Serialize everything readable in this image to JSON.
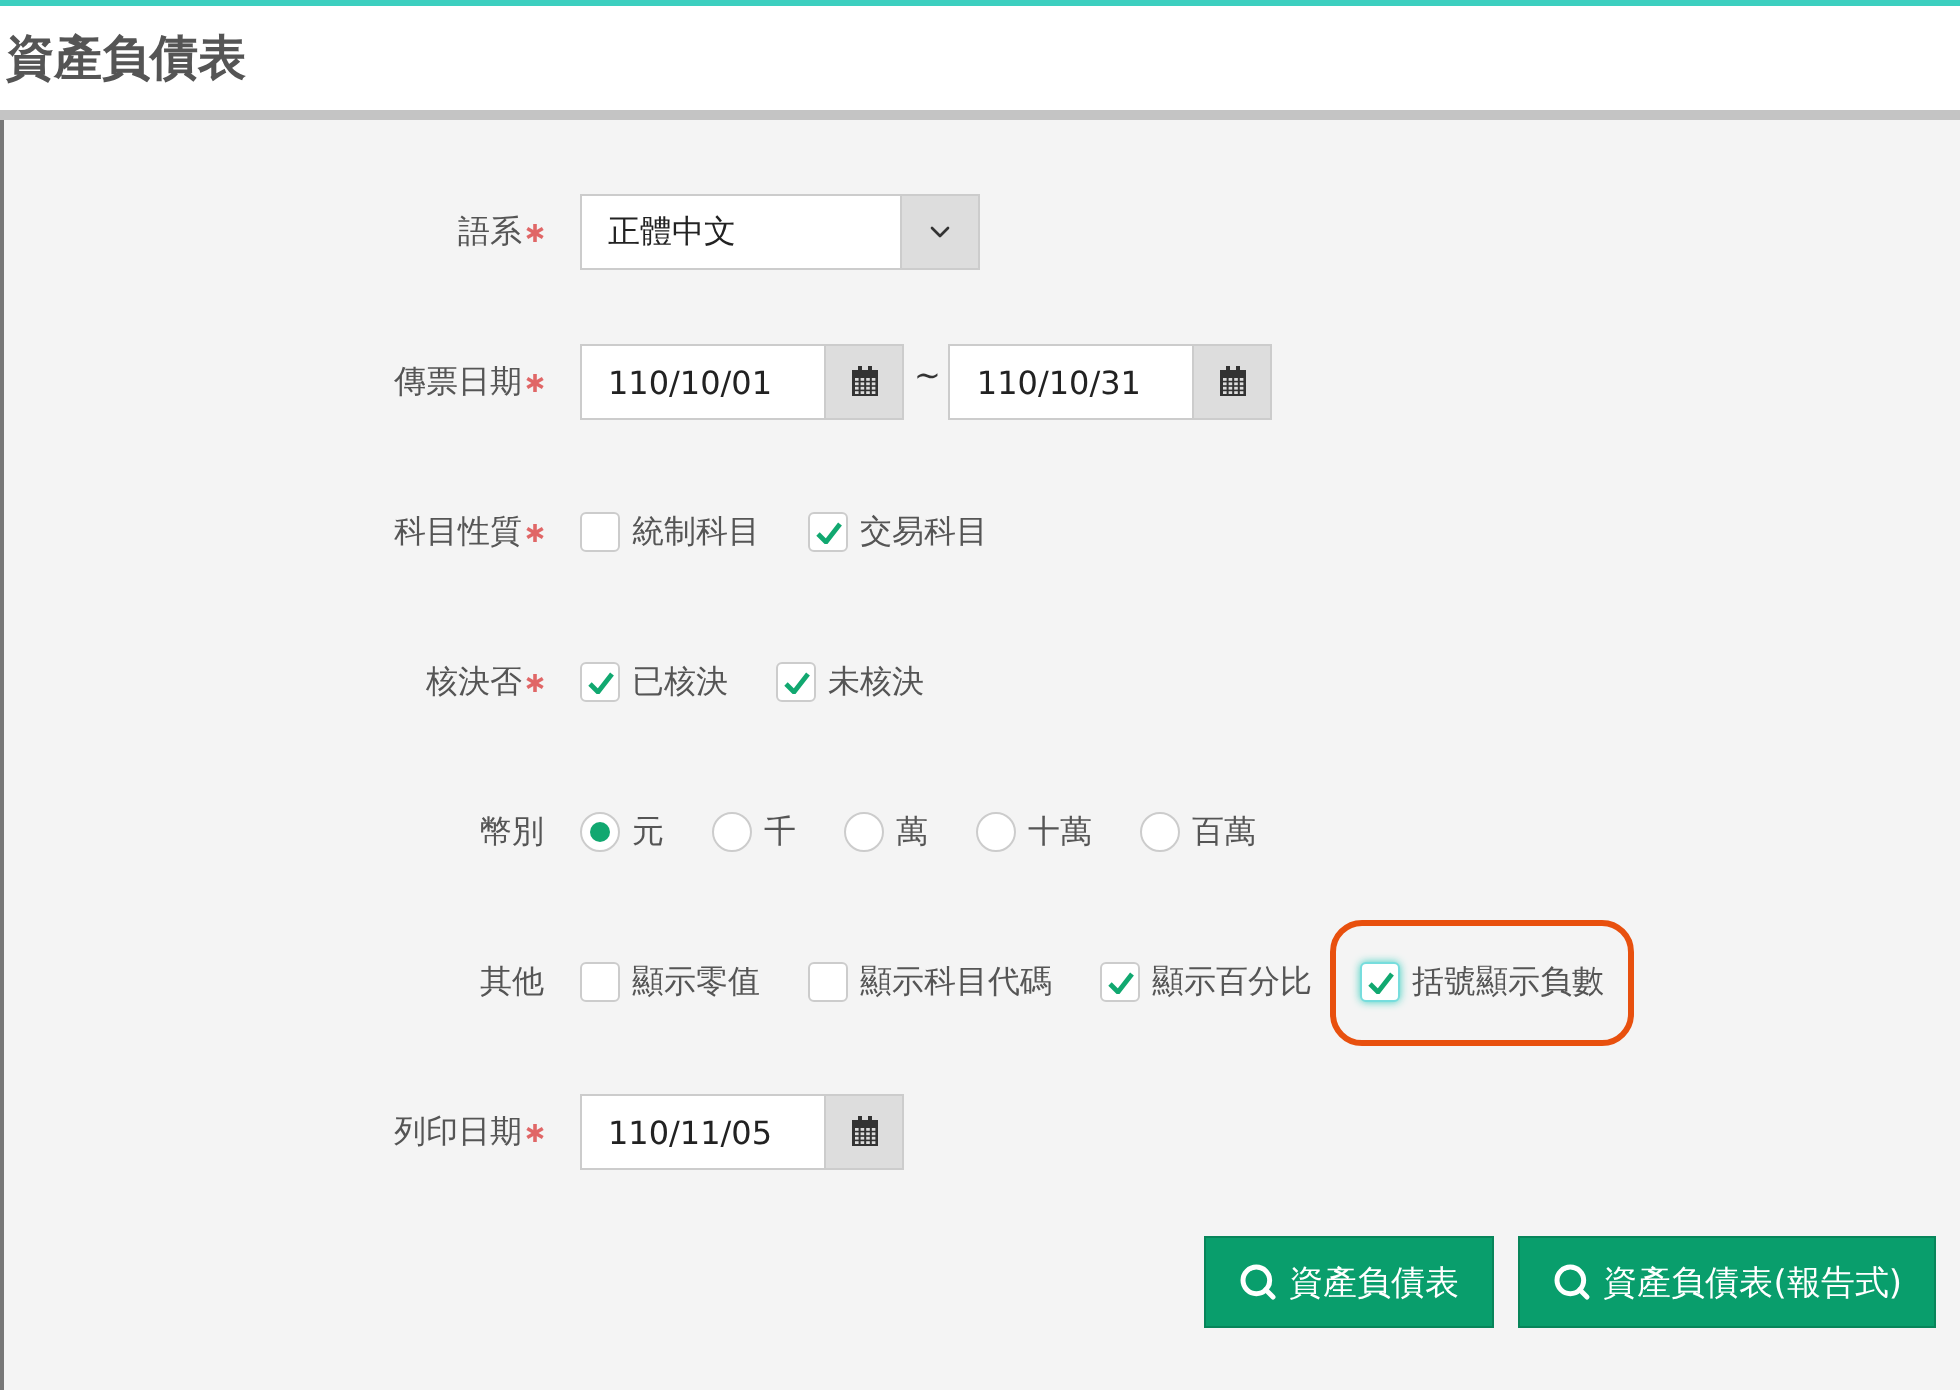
{
  "title": "資產負債表",
  "fields": [
    {
      "kind": "select",
      "label": "語系",
      "required": true,
      "value": "正體中文"
    },
    {
      "kind": "daterange",
      "label": "傳票日期",
      "required": true,
      "from": "110/10/01",
      "separator": "~",
      "to": "110/10/31"
    },
    {
      "kind": "checkbox",
      "label": "科目性質",
      "required": true,
      "options": [
        {
          "label": "統制科目",
          "checked": false,
          "highlighted": false
        },
        {
          "label": "交易科目",
          "checked": true,
          "highlighted": false
        }
      ]
    },
    {
      "kind": "checkbox",
      "label": "核決否",
      "required": true,
      "options": [
        {
          "label": "已核決",
          "checked": true,
          "highlighted": false
        },
        {
          "label": "未核決",
          "checked": true,
          "highlighted": false
        }
      ]
    },
    {
      "kind": "radio",
      "label": "幣別",
      "required": false,
      "options": [
        {
          "label": "元",
          "selected": true
        },
        {
          "label": "千",
          "selected": false
        },
        {
          "label": "萬",
          "selected": false
        },
        {
          "label": "十萬",
          "selected": false
        },
        {
          "label": "百萬",
          "selected": false
        }
      ]
    },
    {
      "kind": "checkbox",
      "label": "其他",
      "required": false,
      "options": [
        {
          "label": "顯示零值",
          "checked": false,
          "highlighted": false
        },
        {
          "label": "顯示科目代碼",
          "checked": false,
          "highlighted": false
        },
        {
          "label": "顯示百分比",
          "checked": true,
          "highlighted": false
        },
        {
          "label": "括號顯示負數",
          "checked": true,
          "highlighted": true
        }
      ]
    },
    {
      "kind": "date",
      "label": "列印日期",
      "required": true,
      "value": "110/11/05"
    }
  ],
  "buttons": [
    "資產負債表",
    "資產負債表(報告式)"
  ]
}
